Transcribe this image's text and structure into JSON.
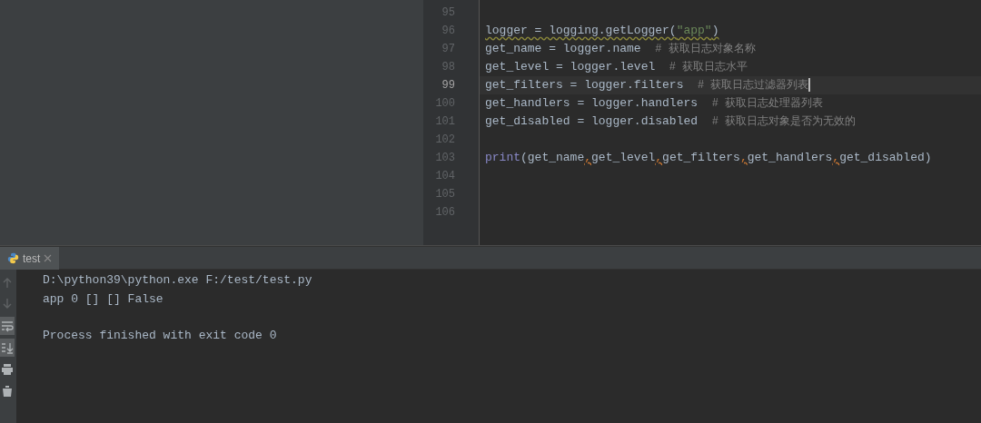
{
  "editor": {
    "lines": [
      {
        "number": "95",
        "current": false
      },
      {
        "number": "96",
        "current": false,
        "warning": true,
        "tokens": [
          {
            "text": "logger = logging.getLogger(",
            "kind": "code"
          },
          {
            "text": "\"app\"",
            "kind": "string"
          },
          {
            "text": ")",
            "kind": "code"
          }
        ]
      },
      {
        "number": "97",
        "current": false,
        "tokens": [
          {
            "text": "get_name = logger.name  ",
            "kind": "code"
          },
          {
            "text": "# 获取日志对象名称",
            "kind": "comment"
          }
        ]
      },
      {
        "number": "98",
        "current": false,
        "tokens": [
          {
            "text": "get_level = logger.level  ",
            "kind": "code"
          },
          {
            "text": "# 获取日志水平",
            "kind": "comment"
          }
        ]
      },
      {
        "number": "99",
        "current": true,
        "tokens": [
          {
            "text": "get_filters = logger.filters  ",
            "kind": "code"
          },
          {
            "text": "# 获取日志过滤器列表",
            "kind": "comment"
          }
        ]
      },
      {
        "number": "100",
        "current": false,
        "tokens": [
          {
            "text": "get_handlers = logger.handlers  ",
            "kind": "code"
          },
          {
            "text": "# 获取日志处理器列表",
            "kind": "comment"
          }
        ]
      },
      {
        "number": "101",
        "current": false,
        "tokens": [
          {
            "text": "get_disabled = logger.disabled  ",
            "kind": "code"
          },
          {
            "text": "# 获取日志对象是否为无效的",
            "kind": "comment"
          }
        ]
      },
      {
        "number": "102",
        "current": false
      },
      {
        "number": "103",
        "current": false,
        "tokens": [
          {
            "text": "print",
            "kind": "builtin"
          },
          {
            "text": "(get_name",
            "kind": "code"
          },
          {
            "text": ",",
            "kind": "comma"
          },
          {
            "text": "get_level",
            "kind": "code"
          },
          {
            "text": ",",
            "kind": "comma"
          },
          {
            "text": "get_filters",
            "kind": "code"
          },
          {
            "text": ",",
            "kind": "comma"
          },
          {
            "text": "get_handlers",
            "kind": "code"
          },
          {
            "text": ",",
            "kind": "comma"
          },
          {
            "text": "get_disabled)",
            "kind": "code"
          }
        ]
      },
      {
        "number": "104",
        "current": false
      },
      {
        "number": "105",
        "current": false
      },
      {
        "number": "106",
        "current": false
      }
    ]
  },
  "run_panel": {
    "tabs": [
      {
        "label": "test",
        "selected": true
      }
    ],
    "tools": [
      {
        "kind": "up",
        "enabled": false,
        "selected": false
      },
      {
        "kind": "down",
        "enabled": false,
        "selected": false
      },
      {
        "kind": "wrap",
        "enabled": true,
        "selected": true
      },
      {
        "kind": "scroll-end",
        "enabled": true,
        "selected": true
      },
      {
        "kind": "print",
        "enabled": true,
        "selected": false
      },
      {
        "kind": "trash",
        "enabled": true,
        "selected": false
      }
    ],
    "console": [
      {
        "text": "D:\\python39\\python.exe F:/test/test.py",
        "blank_before": false
      },
      {
        "text": "app 0 [] [] False",
        "blank_before": false
      },
      {
        "text": "Process finished with exit code 0",
        "blank_before": true
      }
    ]
  }
}
